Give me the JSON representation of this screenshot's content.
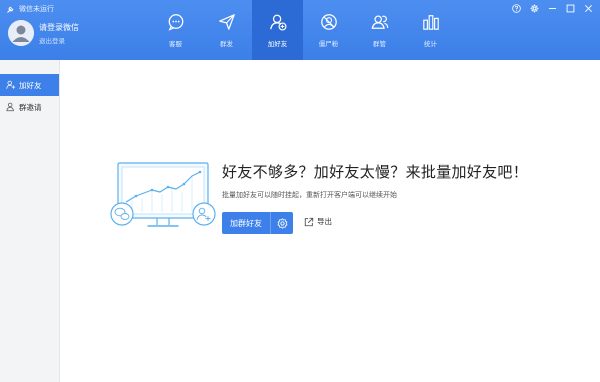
{
  "header": {
    "status_text": "微信未运行",
    "login_title": "请登录微信",
    "login_sub": "退出登录"
  },
  "nav": {
    "items": [
      {
        "label": "客服",
        "icon": "chat-icon"
      },
      {
        "label": "群发",
        "icon": "send-icon"
      },
      {
        "label": "加好友",
        "icon": "add-friend-icon"
      },
      {
        "label": "僵尸粉",
        "icon": "zombie-fans-icon"
      },
      {
        "label": "群管",
        "icon": "group-manage-icon"
      },
      {
        "label": "统计",
        "icon": "statistics-icon"
      }
    ],
    "active": "加好友"
  },
  "sidebar": {
    "items": [
      {
        "label": "加好友",
        "icon": "add-friend-icon"
      },
      {
        "label": "群邀请",
        "icon": "group-invite-icon"
      }
    ]
  },
  "main": {
    "headline": "好友不够多？加好友太慢？来批量加好友吧！",
    "subline": "批量加好友可以随时挂起，重新打开客户端可以继续开始",
    "primary_button": "加群好友",
    "export_label": "导出"
  },
  "colors": {
    "accent": "#3d80ea",
    "header_bg": "#4488ee",
    "nav_active": "#2c6bd6",
    "sidebar_bg": "#f3f4f6",
    "illustration": "#5ab0ef"
  }
}
